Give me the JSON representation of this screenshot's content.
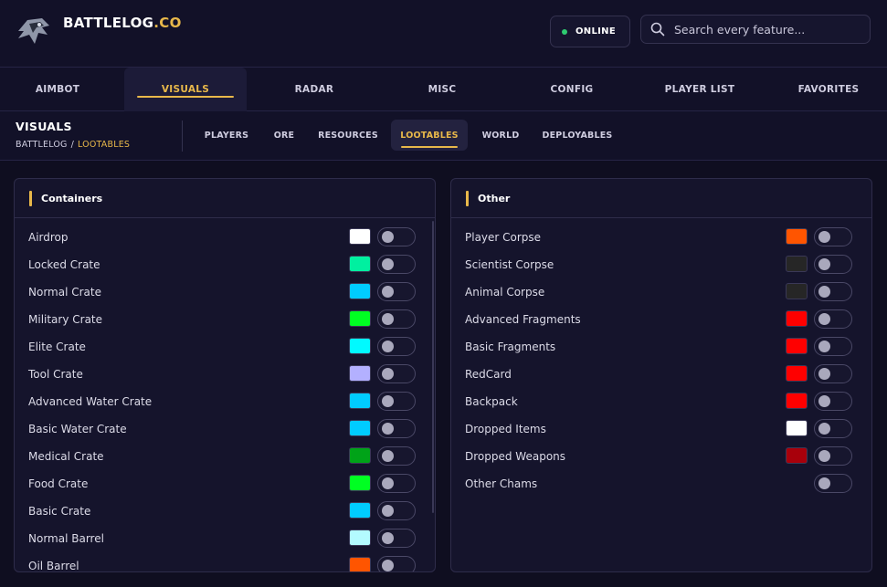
{
  "brand": {
    "name": "BATTLELOG",
    "suffix": ".CO"
  },
  "status": {
    "label": "ONLINE",
    "color": "#2ecc71"
  },
  "search": {
    "placeholder": "Search every feature..."
  },
  "main_nav": [
    {
      "label": "AIMBOT",
      "active": false
    },
    {
      "label": "VISUALS",
      "active": true
    },
    {
      "label": "RADAR",
      "active": false
    },
    {
      "label": "MISC",
      "active": false
    },
    {
      "label": "CONFIG",
      "active": false
    },
    {
      "label": "PLAYER LIST",
      "active": false
    },
    {
      "label": "FAVORITES",
      "active": false
    }
  ],
  "section": {
    "title": "VISUALS",
    "breadcrumb_root": "BATTLELOG",
    "breadcrumb_sep": "/",
    "breadcrumb_current": "LOOTABLES"
  },
  "sub_nav": [
    {
      "label": "PLAYERS",
      "active": false
    },
    {
      "label": "ORE",
      "active": false
    },
    {
      "label": "RESOURCES",
      "active": false
    },
    {
      "label": "LOOTABLES",
      "active": true
    },
    {
      "label": "WORLD",
      "active": false
    },
    {
      "label": "DEPLOYABLES",
      "active": false
    }
  ],
  "accent_color": "#e8b84a",
  "panels": [
    {
      "title": "Containers",
      "items": [
        {
          "label": "Airdrop",
          "color": "#ffffff",
          "enabled": false
        },
        {
          "label": "Locked Crate",
          "color": "#00f0a0",
          "enabled": false
        },
        {
          "label": "Normal Crate",
          "color": "#00ccff",
          "enabled": false
        },
        {
          "label": "Military Crate",
          "color": "#00ff22",
          "enabled": false
        },
        {
          "label": "Elite Crate",
          "color": "#00faff",
          "enabled": false
        },
        {
          "label": "Tool Crate",
          "color": "#b3b0ff",
          "enabled": false
        },
        {
          "label": "Advanced Water Crate",
          "color": "#00ccff",
          "enabled": false
        },
        {
          "label": "Basic Water Crate",
          "color": "#00ccff",
          "enabled": false
        },
        {
          "label": "Medical Crate",
          "color": "#00a318",
          "enabled": false
        },
        {
          "label": "Food Crate",
          "color": "#00ff22",
          "enabled": false
        },
        {
          "label": "Basic Crate",
          "color": "#00ccff",
          "enabled": false
        },
        {
          "label": "Normal Barrel",
          "color": "#b3fbff",
          "enabled": false
        },
        {
          "label": "Oil Barrel",
          "color": "#ff5500",
          "enabled": false
        }
      ]
    },
    {
      "title": "Other",
      "items": [
        {
          "label": "Player Corpse",
          "color": "#ff5500",
          "enabled": false
        },
        {
          "label": "Scientist Corpse",
          "color": "#262626",
          "enabled": false
        },
        {
          "label": "Animal Corpse",
          "color": "#262626",
          "enabled": false
        },
        {
          "label": "Advanced Fragments",
          "color": "#ff0000",
          "enabled": false
        },
        {
          "label": "Basic Fragments",
          "color": "#ff0000",
          "enabled": false
        },
        {
          "label": "RedCard",
          "color": "#ff0000",
          "enabled": false
        },
        {
          "label": "Backpack",
          "color": "#ff0000",
          "enabled": false
        },
        {
          "label": "Dropped Items",
          "color": "#ffffff",
          "enabled": false
        },
        {
          "label": "Dropped Weapons",
          "color": "#a8000b",
          "enabled": false
        },
        {
          "label": "Other Chams",
          "color": null,
          "enabled": false
        }
      ]
    }
  ]
}
